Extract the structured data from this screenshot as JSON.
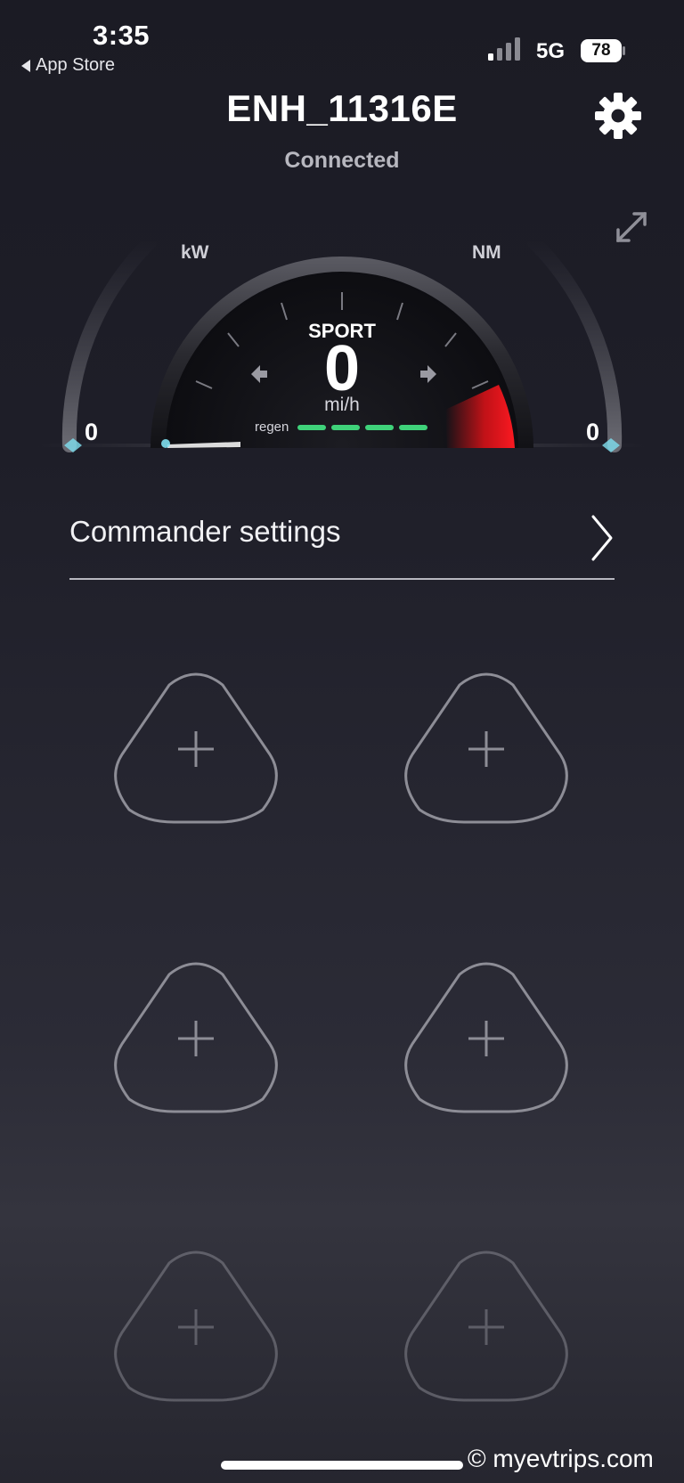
{
  "status_bar": {
    "time": "3:35",
    "back_label": "App Store",
    "network": "5G",
    "battery": "78"
  },
  "header": {
    "device_name": "ENH_11316E",
    "connection_status": "Connected"
  },
  "dashboard": {
    "power_unit": "kW",
    "torque_unit": "NM",
    "power_value": "0",
    "torque_value": "0",
    "mode": "SPORT",
    "speed": "0",
    "speed_unit": "mi/h",
    "regen_label": "regen",
    "regen_level": 4
  },
  "commander": {
    "label": "Commander settings"
  },
  "slots": [
    {
      "icon": "plus-icon"
    },
    {
      "icon": "plus-icon"
    },
    {
      "icon": "plus-icon"
    },
    {
      "icon": "plus-icon"
    },
    {
      "icon": "plus-icon"
    },
    {
      "icon": "plus-icon"
    }
  ],
  "watermark": "© myevtrips.com",
  "colors": {
    "regen": "#3fd27a",
    "redline": "#e01218",
    "accent_glow": "#7fe0f0"
  }
}
